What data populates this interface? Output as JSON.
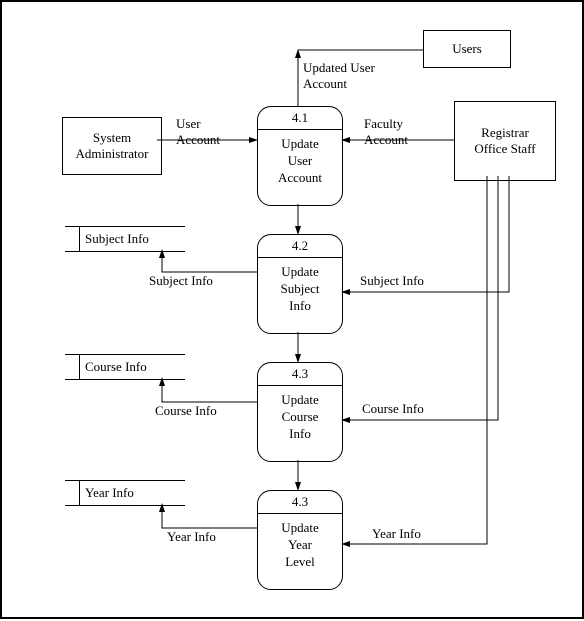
{
  "entities": {
    "sysadmin": "System\nAdministrator",
    "registrar": "Registrar\nOffice Staff",
    "users": "Users"
  },
  "processes": {
    "p1": {
      "num": "4.1",
      "label": "Update\nUser\nAccount"
    },
    "p2": {
      "num": "4.2",
      "label": "Update\nSubject\nInfo"
    },
    "p3": {
      "num": "4.3",
      "label": "Update\nCourse\nInfo"
    },
    "p4": {
      "num": "4.3",
      "label": "Update\nYear\nLevel"
    }
  },
  "stores": {
    "s1": "Subject Info",
    "s2": "Course Info",
    "s3": "Year Info"
  },
  "flows": {
    "f_users": "Updated User\nAccount",
    "f_useracct": "User\nAccount",
    "f_facacct": "Faculty\nAccount",
    "f_subj_out": "Subject Info",
    "f_subj_in": "Subject Info",
    "f_course_out": "Course Info",
    "f_course_in": "Course Info",
    "f_year_out": "Year Info",
    "f_year_in": "Year Info"
  }
}
